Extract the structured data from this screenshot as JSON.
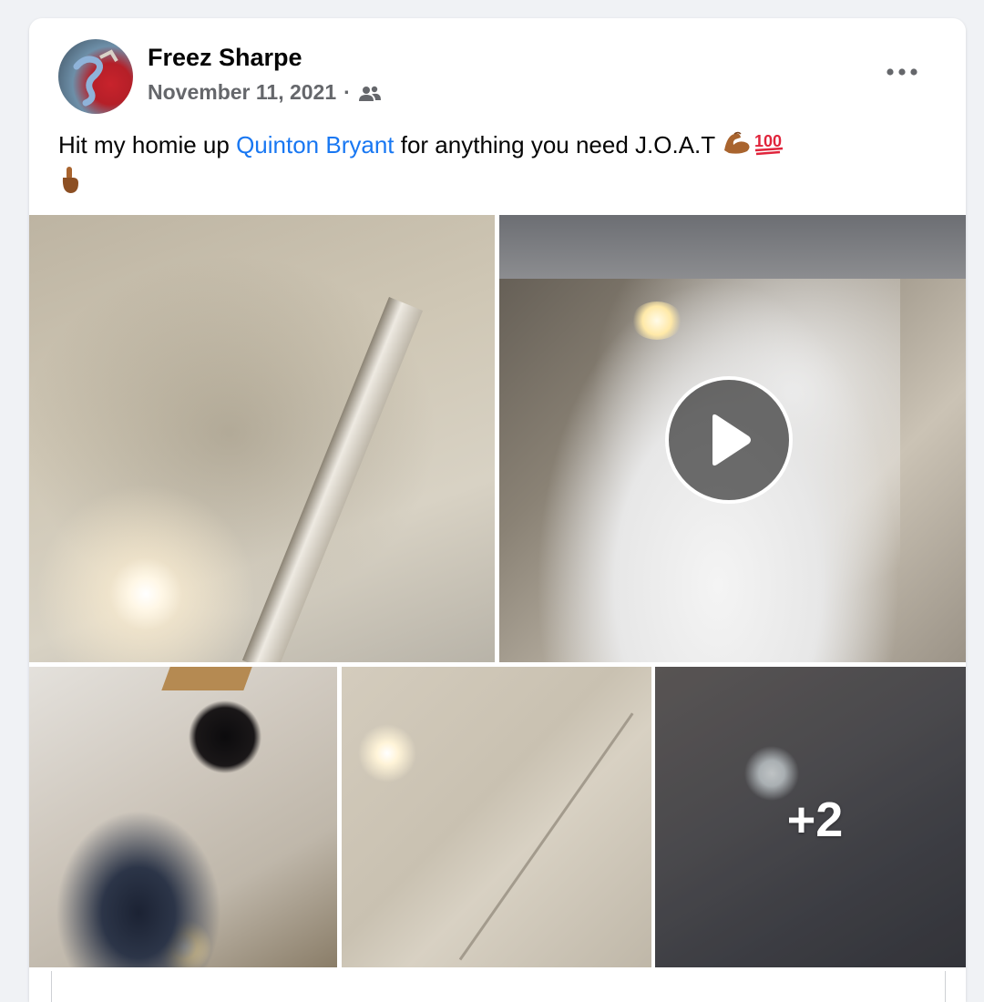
{
  "post": {
    "author": "Freez Sharpe",
    "date": "November 11, 2021",
    "separator": "·",
    "audience_icon": "friends-icon",
    "more_icon": "more-options-icon",
    "text_before": "Hit my homie up ",
    "mention": "Quinton Bryant",
    "text_after": " for anything you need J.O.A.T ",
    "emojis": [
      "flexed-biceps-emoji",
      "hundred-points-emoji",
      "pointing-up-emoji"
    ]
  },
  "media": {
    "photos": [
      {
        "name": "ceiling-stain-photo"
      },
      {
        "name": "insulation-falling-video",
        "is_video": true,
        "play_icon": "play-icon"
      },
      {
        "name": "ceiling-hole-photo"
      },
      {
        "name": "repaired-ceiling-photo"
      },
      {
        "name": "dark-ceiling-photo"
      }
    ],
    "more_count": "+2"
  },
  "colors": {
    "mention": "#1877f2",
    "meta": "#65676b",
    "background": "#f0f2f5"
  }
}
